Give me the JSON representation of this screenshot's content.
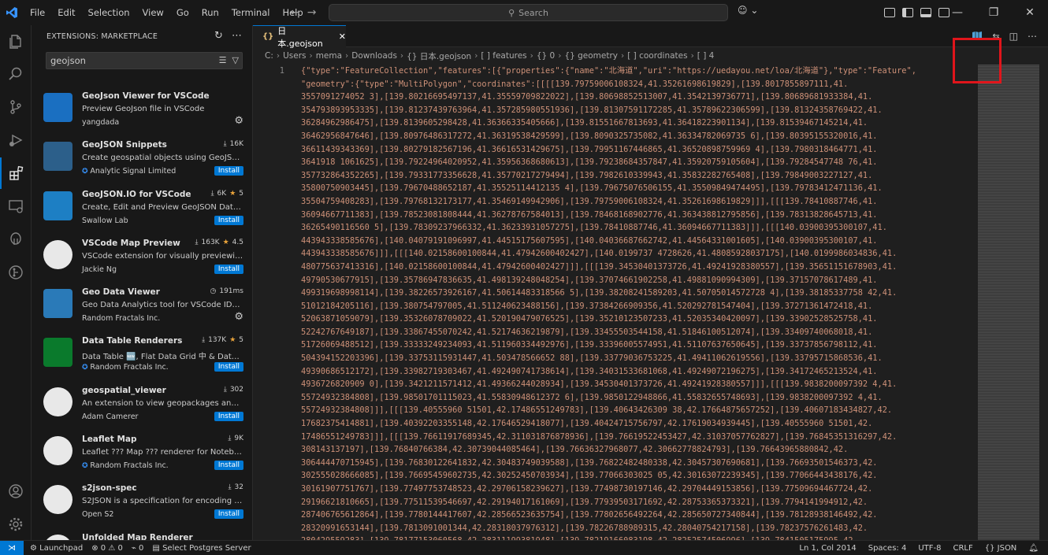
{
  "titlebar": {
    "menu": [
      "File",
      "Edit",
      "Selection",
      "View",
      "Go",
      "Run",
      "Terminal",
      "Help"
    ],
    "search_placeholder": "Search"
  },
  "sidebar": {
    "title": "EXTENSIONS: MARKETPLACE",
    "search_value": "geojson",
    "extensions": [
      {
        "name": "GeoJson Viewer for VSCode",
        "desc": "Preview GeoJson file in VSCode",
        "publisher": "yangdada",
        "meta": "",
        "rating": "",
        "action": "gear"
      },
      {
        "name": "GeoJSON Snippets",
        "desc": "Create geospatial objects using GeoJSO...",
        "publisher": "Analytic Signal Limited",
        "meta": "16K",
        "rating": "",
        "action": "Install",
        "verified": true
      },
      {
        "name": "GeoJSON.IO for VSCode",
        "desc": "Create, Edit and Preview GeoJSON Data ...",
        "publisher": "Swallow Lab",
        "meta": "6K",
        "rating": "5",
        "action": "Install"
      },
      {
        "name": "VSCode Map Preview",
        "desc": "VSCode extension for visually previewin...",
        "publisher": "Jackie Ng",
        "meta": "163K",
        "rating": "4.5",
        "action": "Install"
      },
      {
        "name": "Geo Data Viewer",
        "desc": "Geo Data Analytics tool for VSCode IDE ...",
        "publisher": "Random Fractals Inc.",
        "meta": "191ms",
        "rating": "",
        "action": "gear"
      },
      {
        "name": "Data Table Renderers",
        "desc": "Data Table 🆕, Flat Data Grid 中 & Data...",
        "publisher": "Random Fractals Inc.",
        "meta": "137K",
        "rating": "5",
        "action": "Install",
        "verified": true
      },
      {
        "name": "geospatial_viewer",
        "desc": "An extension to view geopackages and ...",
        "publisher": "Adam Camerer",
        "meta": "302",
        "rating": "",
        "action": "Install"
      },
      {
        "name": "Leaflet Map",
        "desc": "Leaflet ??? Map ??? renderer for Notebo...",
        "publisher": "Random Fractals Inc.",
        "meta": "9K",
        "rating": "",
        "action": "Install",
        "verified": true
      },
      {
        "name": "s2json-spec",
        "desc": "S2JSON is a specification for encoding a...",
        "publisher": "Open S2",
        "meta": "32",
        "rating": "",
        "action": "Install"
      },
      {
        "name": "Unfolded Map Renderer",
        "desc": "",
        "publisher": "",
        "meta": "",
        "rating": "",
        "action": ""
      }
    ]
  },
  "editor": {
    "tab_label": "日本.geojson",
    "breadcrumb": [
      "C:",
      "Users",
      "mema",
      "Downloads",
      "{} 日本.geojson",
      "[ ] features",
      "{} 0",
      "{} geometry",
      "[ ] coordinates",
      "[ ] 4"
    ],
    "line_number": "1",
    "lines": [
      "{\"type\":\"FeatureCollection\",\"features\":[{\"properties\":{\"name\":\"北海道\",\"uri\":\"https://uedayou.net/loa/北海道\"},\"type\":\"Feature\",",
      "\"geometry\":{\"type\":\"MultiPolygon\",\"coordinates\":[[[[139.79759006108324,41.35261698619829],[139.8017855897111,41.",
      "3557091274052 3],[139.80216695497137,41.35559709822022],[139.80698852513007,41.3542139736771],[139.80689681933384,41.",
      "354793893953335],[139.81237439763964,41.357285980551936],[139.81307591172285,41.35789622306599],[139.81324358769422,41.",
      "36284962986475],[139.8139605298428,41.36366335405666],[139.81551667813693,41.36418223901134],[139.81539467145214,41.",
      "36462956847646],[139.80976486317272,41.36319538429599],[139.8090325735082,41.36334782069735 6],[139.80395155320016,41.",
      "36611439343369],[139.80279182567196,41.36616531429675],[139.79951167446865,41.36520898759969 4],[139.7980318464771,41.",
      "3641918 1061625],[139.79224964020952,41.35956368680613],[139.79238684357847,41.35920759105604],[139.79284547748 76,41.",
      "357732864352265],[139.79331773356628,41.35770217279494],[139.7982610339943,41.35832282765408],[139.79849003227127,41.",
      "35800750903445],[139.79670488652187,41.35525114412135 4],[139.79675076506155,41.35509849474495],[139.79783412471136,41.",
      "35504759408283],[139.79768132173177,41.35469149942906],[139.79759006108324,41.35261698619829]]],[[[139.78410887746,41.",
      "36094667711383],[139.78523081808444,41.36278767584013],[139.78468168902776,41.363438812795856],[139.78313828645713,41.",
      "36265490116560 5],[139.78309237966332,41.36233931057275],[139.78410887746,41.36094667711383]]],[[[140.03900395300107,41.",
      "443943338585676],[140.04079191096997,41.44515175607595],[140.04036687662742,41.44564331001605],[140.03900395300107,41.",
      "443943338585676]]],[[[140.02158600100844,41.47942600402427],[140.0199737 4728626,41.48085928037175],[140.0199986034836,41.",
      "480775637413316],[140.02158600100844,41.47942600402427]]],[[[139.34530401373726,41.49241928380557],[139.35651151678903,41.",
      "49790530677915],[139.35786947836635,41.498139248048254],[139.37074661902258,41.49881090994309],[139.37157078617489,41.",
      "499319698998114],[139.38226573926167,41.50614483318566 5],[139.38208241589203,41.50705014572728 4],[139.38185337758 42,41.",
      "51012184205116],[139.380754797005,41.511240623488156],[139.37384266909356,41.520292781547404],[139.37271361472418,41.",
      "52063871059079],[139.35326078709022,41.520190479076525],[139.35210123507233,41.52035340420097],[139.33902528525758,41.",
      "52242767649187],[139.33867455070242,41.52174636219879],[139.33455503544158,41.51846100512074],[139.33409740068018,41.",
      "51726069488512],[139.33333249234093,41.511960334492976],[139.33396005574951,41.51107637650645],[139.33737856798112,41.",
      "504394152203396],[139.33753115931447,41.503478566652 88],[139.33779036753225,41.49411062619556],[139.33795715868536,41.",
      "49390686512172],[139.33982719303467,41.492490741738614],[139.34031533681068,41.49249072196275],[139.34172465213524,41.",
      "4936726820909 0],[139.3421211571412,41.49366244028934],[139.34530401373726,41.49241928380557]]],[[[139.9838200097392 4,41.",
      "55724932384808],[139.98501701115023,41.55830948612372 6],[139.9850122948866,41.55832655748693],[139.9838200097392 4,41.",
      "55724932384808]]],[[[139.40555960 51501,42.17486551249783],[139.40643426309 38,42.17664875657252],[139.40607183434827,42.",
      "17682375414881],[139.40392203355148,42.17646529418077],[139.40424715756797,42.17619034939445],[139.40555960 51501,42.",
      "17486551249783]]],[[[139.76611917689345,42.311031876878936],[139.76619522453427,42.31037057762827],[139.76845351316297,42.",
      "308143137197],[139.76840766384,42.30739044085464],[139.76636327968077,42.30662778824793],[139.76643965880842,42.",
      "306444470715945],[139.76830122641832,42.30483749039588],[139.76822482480338,42.30457307690681],[139.76693501546373,42.",
      "302555028666085],[139.76695459602735,42.30252450703934],[139.77066303025 05,42.30163072239345],[139.77066443438176,42.",
      "30161907751767],[139.77497753748523,42.29706158239627],[139.77498730197146,42.29704449153856],[139.77509694467724,42.",
      "29196621810665],[139.77511539546697,42.29194017161069],[139.77939503171692,42.28753365373321],[139.7794141994912,42.",
      "287406765612864],[139.7780144417607,42.28566523635754],[139.77802656492264,42.285650727340844],[139.78128938146492,42.",
      "28320991653144],[139.7813091001344,42.28318037976312],[139.78226788989315,42.28040754217158],[139.78237576261483,42.",
      "280429559283],[139.78177153060568,42.28311199381948],[139.78219166083198,42.28252574506996],[139.7841505175995,42."
    ]
  },
  "statusbar": {
    "launchpad": "Launchpad",
    "errors": "0",
    "warnings": "0",
    "ports": "0",
    "postgres": "Select Postgres Server",
    "position": "Ln 1, Col 2014",
    "spaces": "Spaces: 4",
    "encoding": "UTF-8",
    "eol": "CRLF",
    "language": "JSON"
  },
  "colors": {
    "accent": "#0078d4",
    "highlight_box": "#e0151b"
  }
}
